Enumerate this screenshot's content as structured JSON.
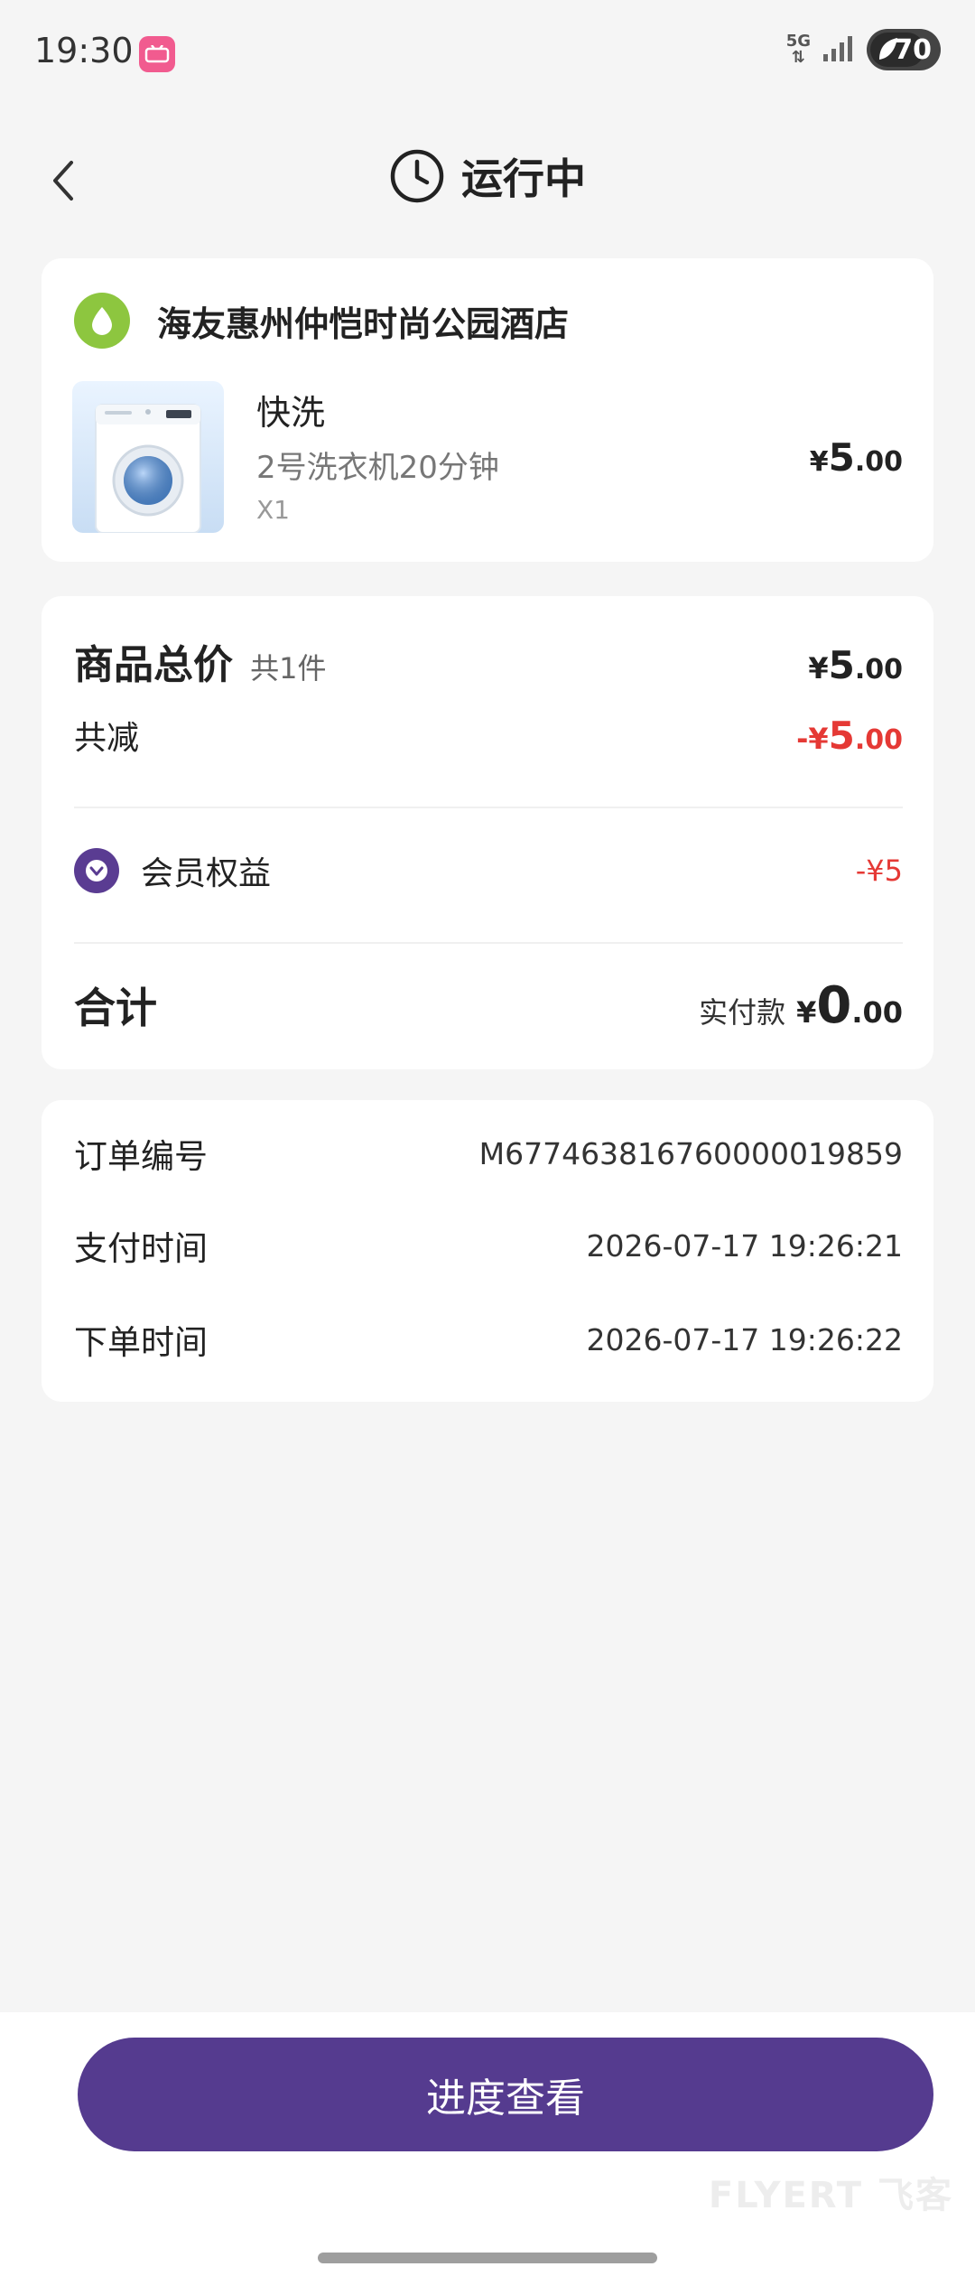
{
  "status_bar": {
    "time": "19:30",
    "network": "5G",
    "battery": "70"
  },
  "header": {
    "title": "运行中"
  },
  "store": {
    "name": "海友惠州仲恺时尚公园酒店",
    "product": {
      "name": "快洗",
      "desc": "2号洗衣机20分钟",
      "qty": "X1",
      "price_currency": "¥",
      "price_int": "5",
      "price_dec": ".00"
    }
  },
  "summary": {
    "total_label": "商品总价",
    "total_count": "共1件",
    "total_cur": "¥",
    "total_int": "5",
    "total_dec": ".00",
    "discount_label": "共减",
    "discount_cur": "-¥",
    "discount_int": "5",
    "discount_dec": ".00",
    "vip_label": "会员权益",
    "vip_value": "-¥5",
    "sum_label": "合计",
    "paid_prefix": "实付款",
    "paid_cur": "¥",
    "paid_int": "0",
    "paid_dec": ".00"
  },
  "order_info": {
    "rows": [
      {
        "label": "订单编号",
        "value": "M677463816760000019859"
      },
      {
        "label": "支付时间",
        "value": "2026-07-17 19:26:21"
      },
      {
        "label": "下单时间",
        "value": "2026-07-17 19:26:22"
      }
    ]
  },
  "bottom": {
    "button_label": "进度查看",
    "watermark": "FLYERT 飞客"
  },
  "colors": {
    "accent": "#553b8f",
    "discount": "#e53935",
    "store_logo": "#8dc63f"
  }
}
